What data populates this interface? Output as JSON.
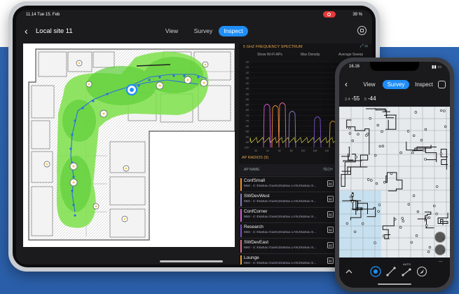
{
  "tablet": {
    "status": {
      "time": "11.14  Tue 15. Feb",
      "battery": "39 %"
    },
    "nav": {
      "title": "Local site 11",
      "tabs": [
        {
          "label": "View",
          "active": false
        },
        {
          "label": "Survey",
          "active": false
        },
        {
          "label": "Inspect",
          "active": true
        }
      ]
    },
    "spectrum": {
      "title": "5 GHZ FREQUENCY SPECTRUM",
      "options": [
        "Show Wi-Fi APs",
        "Max Density",
        "Average Sweep"
      ],
      "y_ticks": [
        "-20",
        "-25",
        "-30",
        "-35",
        "-40",
        "-45",
        "-50",
        "-55",
        "-60",
        "-65",
        "-70",
        "-75",
        "-80",
        "-85",
        "-90",
        "-95",
        "-100"
      ],
      "x_ticks": [
        "36",
        "44",
        "52",
        "60",
        "100",
        "108",
        "116",
        "124",
        "132",
        "140"
      ]
    },
    "ap_radios": {
      "title": "AP RADIOS (9)",
      "columns": [
        "AP NAME",
        "TECH",
        "CH"
      ],
      "rows": [
        {
          "name": "ConfSmall",
          "sub": "Mist - 4: Ekahau Guest,Ekahau LAN,Ekahau S...",
          "ch": "136",
          "ch2": "20",
          "color": "#f28c28"
        },
        {
          "name": "SWDevWest",
          "sub": "Mist - 4: Ekahau Guest,Ekahau LAN,Ekahau S...",
          "ch": "52",
          "ch2": "20",
          "color": "#8b79c9"
        },
        {
          "name": "ConfCorner",
          "sub": "Mist - 4: Ekahau Guest,Ekahau LAN,Ekahau S...",
          "ch": "56",
          "ch2": "20",
          "color": "#d65bd6"
        },
        {
          "name": "Research",
          "sub": "Mist - 4: Ekahau Guest,Ekahau LAN,Ekahau S...",
          "ch": "100",
          "ch2": "20",
          "color": "#7a4fc9"
        },
        {
          "name": "SWDevEast",
          "sub": "Mist - 4: Ekahau Guest,Ekahau LAN,Ekahau S...",
          "ch": "60",
          "ch2": "20",
          "color": "#e36e8f"
        },
        {
          "name": "Lounge",
          "sub": "Mist - 4: Ekahau Guest,Ekahau LAN,Ekahau S...",
          "ch": "140",
          "ch2": "20",
          "color": "#f0a030"
        }
      ]
    }
  },
  "phone": {
    "status": {
      "time": "16.16"
    },
    "nav": {
      "tabs": [
        {
          "label": "View",
          "active": false
        },
        {
          "label": "Survey",
          "active": true
        },
        {
          "label": "Inspect",
          "active": false
        }
      ]
    },
    "signal": {
      "band1_label": "2.4",
      "band1_value": "-55",
      "band2_label": "5",
      "band2_value": "-44"
    },
    "bottom": {
      "auto_label": "AUTO",
      "more": "..."
    }
  },
  "colors": {
    "accent": "#1f8ef7",
    "heatmap": "#7ee04a",
    "background_blue": "#2f66b2",
    "orange_title": "#e1a34a"
  }
}
